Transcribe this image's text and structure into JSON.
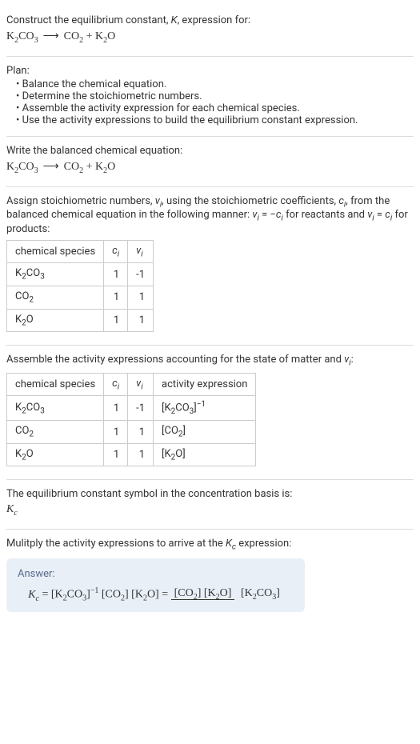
{
  "header": {
    "prompt": "Construct the equilibrium constant, K, expression for:",
    "equation_lhs": "K₂CO₃",
    "equation_rhs": "CO₂ + K₂O"
  },
  "plan": {
    "title": "Plan:",
    "items": [
      "Balance the chemical equation.",
      "Determine the stoichiometric numbers.",
      "Assemble the activity expression for each chemical species.",
      "Use the activity expressions to build the equilibrium constant expression."
    ]
  },
  "balanced": {
    "text": "Write the balanced chemical equation:",
    "equation_lhs": "K₂CO₃",
    "equation_rhs": "CO₂ + K₂O"
  },
  "stoich": {
    "text": "Assign stoichiometric numbers, νᵢ, using the stoichiometric coefficients, cᵢ, from the balanced chemical equation in the following manner: νᵢ = −cᵢ for reactants and νᵢ = cᵢ for products:",
    "table": {
      "headers": [
        "chemical species",
        "cᵢ",
        "νᵢ"
      ],
      "rows": [
        {
          "species": "K₂CO₃",
          "c": "1",
          "v": "-1"
        },
        {
          "species": "CO₂",
          "c": "1",
          "v": "1"
        },
        {
          "species": "K₂O",
          "c": "1",
          "v": "1"
        }
      ]
    }
  },
  "activity": {
    "text": "Assemble the activity expressions accounting for the state of matter and νᵢ:",
    "table": {
      "headers": [
        "chemical species",
        "cᵢ",
        "νᵢ",
        "activity expression"
      ],
      "rows": [
        {
          "species": "K₂CO₃",
          "c": "1",
          "v": "-1",
          "expr": "[K₂CO₃]⁻¹"
        },
        {
          "species": "CO₂",
          "c": "1",
          "v": "1",
          "expr": "[CO₂]"
        },
        {
          "species": "K₂O",
          "c": "1",
          "v": "1",
          "expr": "[K₂O]"
        }
      ]
    }
  },
  "symbol": {
    "text": "The equilibrium constant symbol in the concentration basis is:",
    "value": "K_c"
  },
  "multiply": {
    "text": "Mulitply the activity expressions to arrive at the K_c expression:"
  },
  "answer": {
    "label": "Answer:",
    "lhs": "K_c = [K₂CO₃]⁻¹ [CO₂] [K₂O] = ",
    "frac_num": "[CO₂] [K₂O]",
    "frac_den": "[K₂CO₃]"
  }
}
